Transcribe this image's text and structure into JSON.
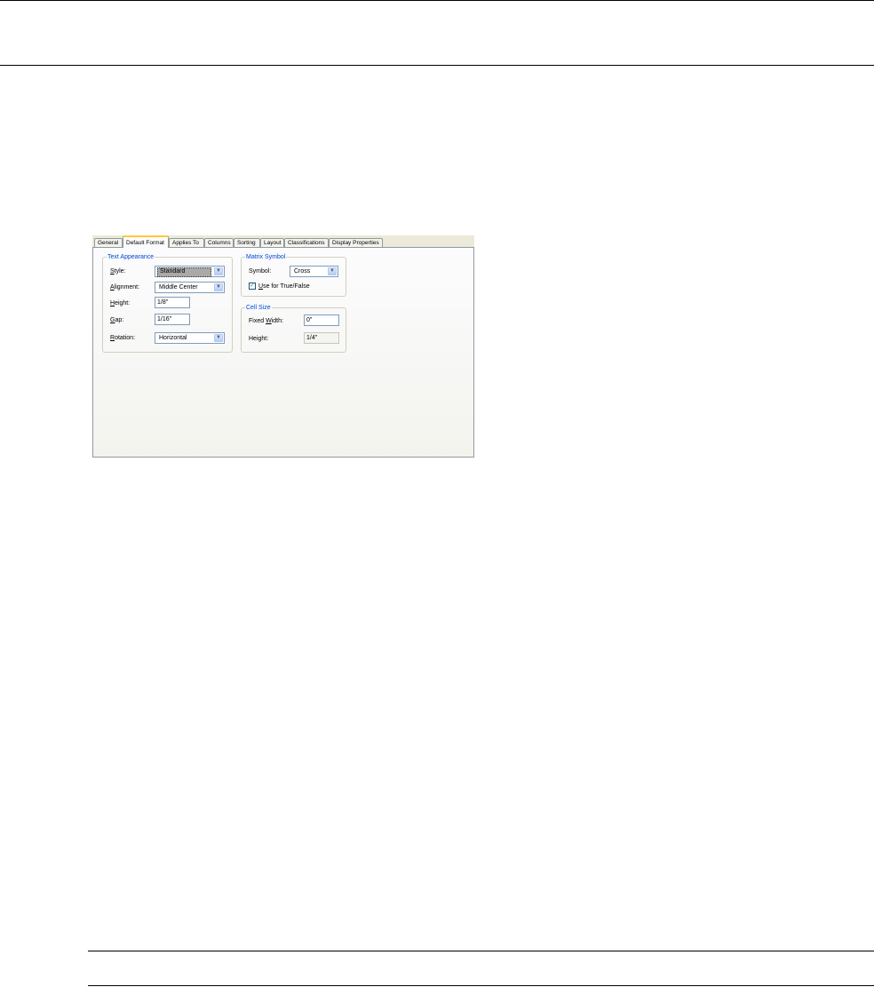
{
  "tabs": [
    {
      "label": "General",
      "active": false
    },
    {
      "label": "Default Format",
      "active": true
    },
    {
      "label": "Applies To",
      "active": false
    },
    {
      "label": "Columns",
      "active": false
    },
    {
      "label": "Sorting",
      "active": false
    },
    {
      "label": "Layout",
      "active": false
    },
    {
      "label": "Classifications",
      "active": false
    },
    {
      "label": "Display Properties",
      "active": false
    }
  ],
  "text_appearance": {
    "title": "Text Appearance",
    "style": {
      "label_key": "S",
      "label_rest": "tyle:",
      "value": "Standard"
    },
    "alignment": {
      "label_key": "A",
      "label_rest": "lignment:",
      "value": "Middle Center"
    },
    "height": {
      "label_key": "H",
      "label_rest": "eight:",
      "value": "1/8\""
    },
    "gap": {
      "label_key": "G",
      "label_rest": "ap:",
      "value": "1/16\""
    },
    "rotation": {
      "label_key": "R",
      "label_rest": "otation:",
      "value": "Horizontal"
    }
  },
  "matrix_symbol": {
    "title": "Matrix Symbol",
    "symbol": {
      "label": "Symbol:",
      "value": "Cross"
    },
    "use_true_false": {
      "label_key": "U",
      "label_rest": "se for True/False",
      "checked": true
    }
  },
  "cell_size": {
    "title": "Cell Size",
    "fixed_width": {
      "label_pre": "Fixed ",
      "label_key": "W",
      "label_rest": "idth:",
      "value": "0\""
    },
    "height": {
      "label": "Height:",
      "value": "1/4\""
    }
  },
  "colors": {
    "group_title": "#0046d5",
    "active_tab_accent": "#ffc83c"
  },
  "icons": {
    "dropdown": "chevron-down-icon",
    "check": "checkmark-icon"
  }
}
